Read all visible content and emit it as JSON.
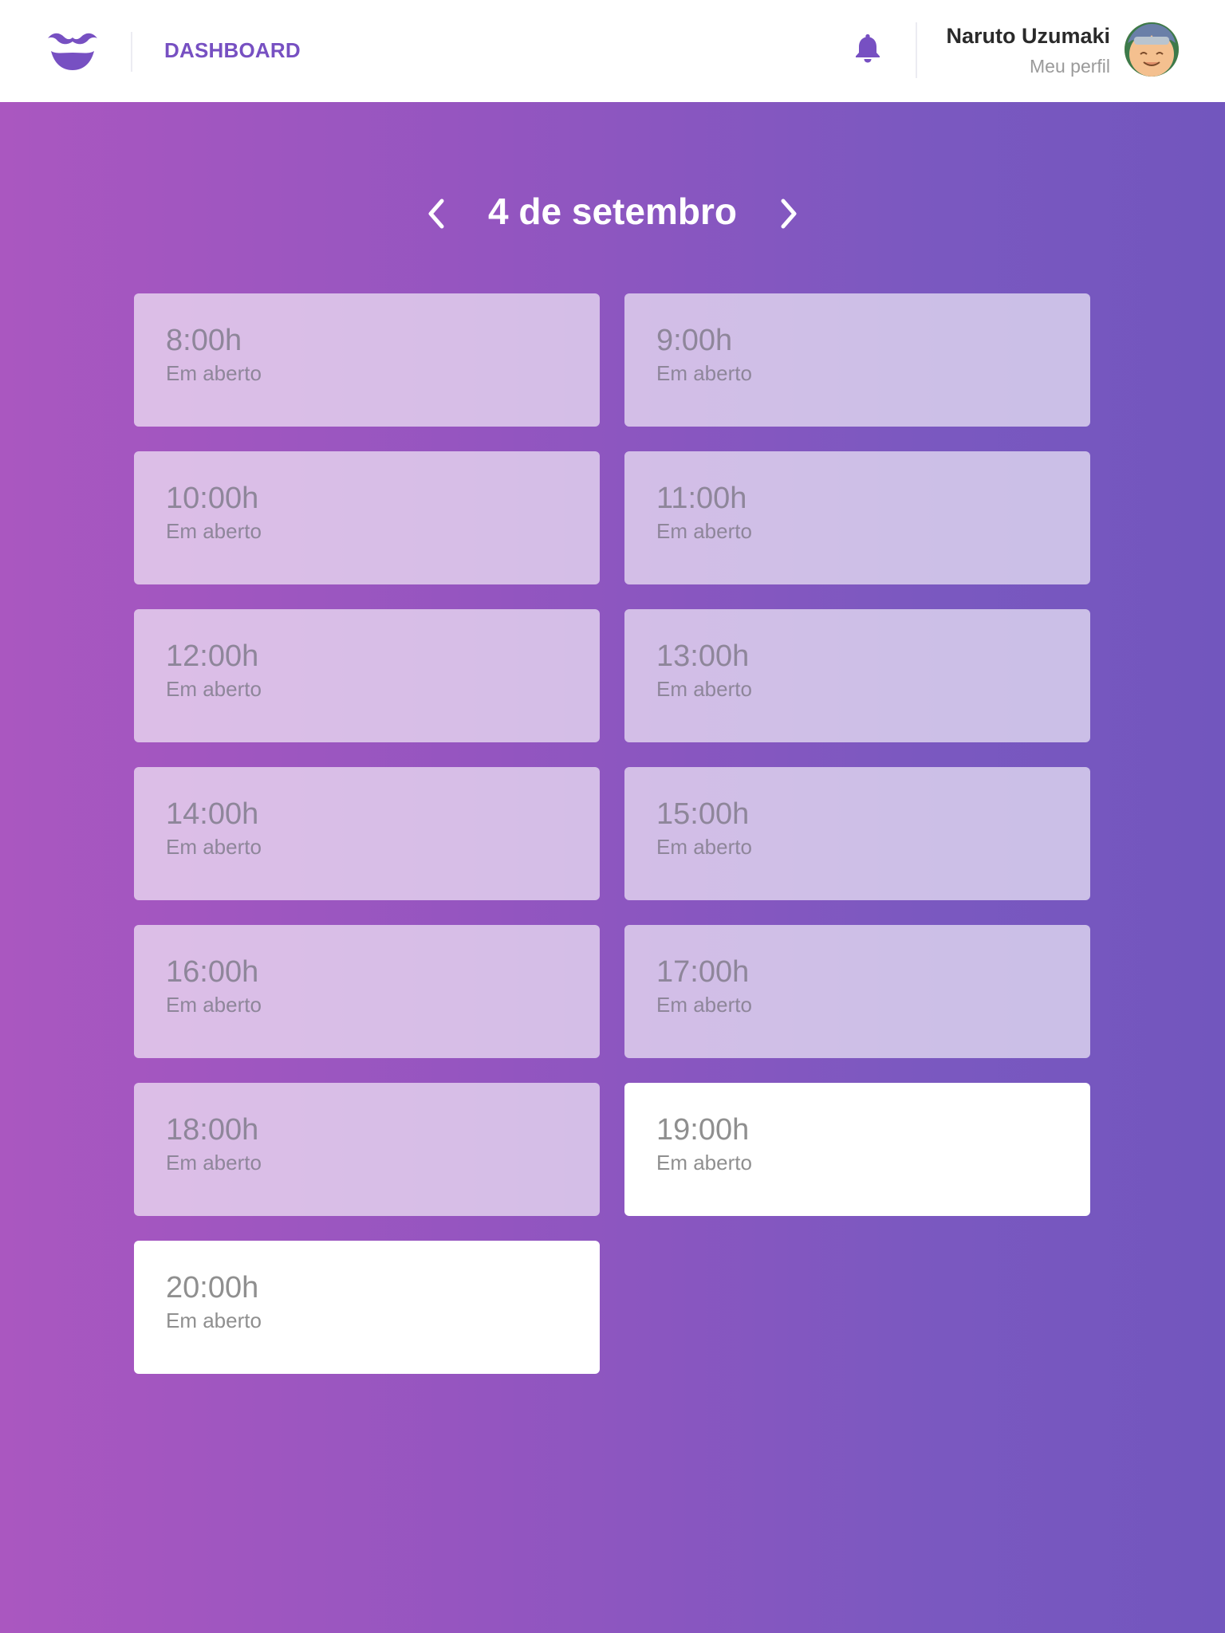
{
  "header": {
    "nav_label": "DASHBOARD",
    "user_name": "Naruto Uzumaki",
    "profile_link": "Meu perfil",
    "logo_icon": "mustache-smile-icon",
    "notification_icon": "bell-icon",
    "accent_color": "#7750c2"
  },
  "date_nav": {
    "title": "4 de setembro",
    "prev_icon": "chevron-left-icon",
    "next_icon": "chevron-right-icon"
  },
  "slots": [
    {
      "time": "8:00h",
      "status": "Em aberto",
      "highlighted": false
    },
    {
      "time": "9:00h",
      "status": "Em aberto",
      "highlighted": false
    },
    {
      "time": "10:00h",
      "status": "Em aberto",
      "highlighted": false
    },
    {
      "time": "11:00h",
      "status": "Em aberto",
      "highlighted": false
    },
    {
      "time": "12:00h",
      "status": "Em aberto",
      "highlighted": false
    },
    {
      "time": "13:00h",
      "status": "Em aberto",
      "highlighted": false
    },
    {
      "time": "14:00h",
      "status": "Em aberto",
      "highlighted": false
    },
    {
      "time": "15:00h",
      "status": "Em aberto",
      "highlighted": false
    },
    {
      "time": "16:00h",
      "status": "Em aberto",
      "highlighted": false
    },
    {
      "time": "17:00h",
      "status": "Em aberto",
      "highlighted": false
    },
    {
      "time": "18:00h",
      "status": "Em aberto",
      "highlighted": false
    },
    {
      "time": "19:00h",
      "status": "Em aberto",
      "highlighted": true
    },
    {
      "time": "20:00h",
      "status": "Em aberto",
      "highlighted": true
    }
  ],
  "colors": {
    "background_gradient_start": "#aa57c0",
    "background_gradient_end": "#7256be",
    "slot_text": "#8e869a"
  }
}
